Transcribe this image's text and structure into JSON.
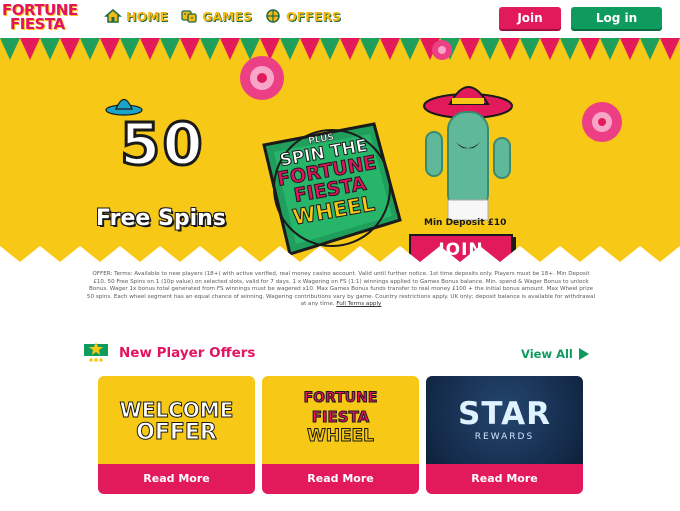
{
  "header": {
    "logo_line1": "FORTUNE",
    "logo_line2": "FIESTA",
    "nav": [
      {
        "label": "HOME",
        "icon": "home-icon"
      },
      {
        "label": "GAMES",
        "icon": "dice-icon"
      },
      {
        "label": "OFFERS",
        "icon": "gift-icon"
      }
    ],
    "join_label": "Join",
    "login_label": "Log in"
  },
  "banner": {
    "big_number": "50",
    "free_spins": "Free Spins",
    "plus": "PLUS",
    "line1": "SPIN THE",
    "line2": "FORTUNE FIESTA",
    "line3": "WHEEL",
    "min_deposit": "Min Deposit £10",
    "join_label": "JOIN"
  },
  "terms": {
    "text": "OFFER: Terms: Available to new players (18+) with active verified, real money casino account. Valid until further notice. 1st time deposits only. Players must be 18+. Min Deposit £10. 50 Free Spins on 1 (10p value) on selected slots, valid for 7 days. 1 x Wagering on FS (1:1) winnings applied to Games Bonus balance. Min. spend & Wager Bonus to unlock Bonus. Wager 1x bonus total generated from FS winnings must be wagered x10. Max Games Bonus funds transfer to real money £100 + the initial bonus amount. Max Wheel prize 50 spins. Each wheel segment has an equal chance of winning. Wagering contributions vary by game. Country restrictions apply. UK only; deposit balance is available for withdrawal at any time.",
    "link_label": "Full Terms apply"
  },
  "offers": {
    "title": "New Player Offers",
    "view_all": "View All",
    "cards": [
      {
        "title_l1": "WELCOME",
        "title_l2": "OFFER",
        "cta": "Read More"
      },
      {
        "title_l1": "FORTUNE",
        "title_l2": "FIESTA",
        "title_l3": "WHEEL",
        "cta": "Read More"
      },
      {
        "title_l1": "STAR",
        "title_l2": "REWARDS",
        "cta": "Read More"
      }
    ]
  },
  "colors": {
    "brand_pink": "#e21a5b",
    "brand_green": "#0f9a5e",
    "banner_yellow": "#f7c916"
  }
}
